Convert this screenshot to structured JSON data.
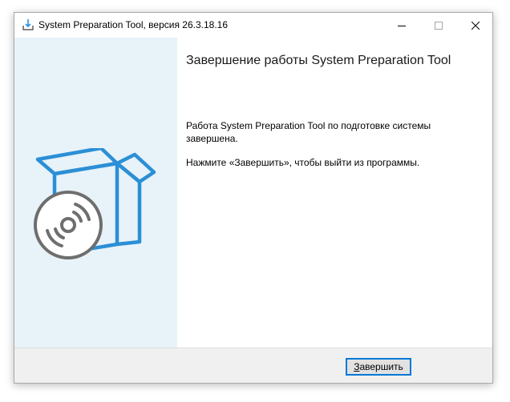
{
  "window": {
    "title": "System Preparation Tool, версия 26.3.18.16",
    "icon": "sysprep-app-icon",
    "controls": [
      "minimize-icon",
      "maximize-icon",
      "close-icon"
    ]
  },
  "side_panel": {
    "illustration": "box-with-disc-icon",
    "background_color": "#e8f2f9",
    "accent_color": "#2b8fd6"
  },
  "content": {
    "heading": "Завершение работы System Preparation Tool",
    "paragraph1": "Работа System Preparation Tool по подготовке системы завершена.",
    "paragraph2": "Нажмите «Завершить», чтобы выйти из программы."
  },
  "footer": {
    "finish_button": {
      "mnemonic": "З",
      "rest": "авершить"
    }
  }
}
